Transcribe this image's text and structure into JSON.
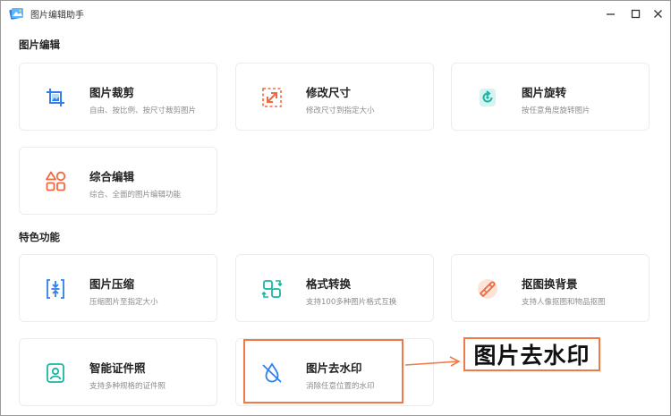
{
  "window": {
    "title": "图片编辑助手",
    "icons": {
      "app": "app-logo-icon",
      "minimize": "minimize-icon",
      "maximize": "maximize-icon",
      "close": "close-icon"
    }
  },
  "sections": [
    {
      "title": "图片编辑",
      "cards": [
        {
          "title": "图片裁剪",
          "desc": "自由、按比例、按尺寸裁剪图片",
          "icon": "crop-icon",
          "color": "#2f80ed"
        },
        {
          "title": "修改尺寸",
          "desc": "修改尺寸到指定大小",
          "icon": "resize-icon",
          "color": "#f06a3f"
        },
        {
          "title": "图片旋转",
          "desc": "按任意角度旋转图片",
          "icon": "rotate-icon",
          "color": "#19b5a5"
        },
        {
          "title": "综合编辑",
          "desc": "综合、全面的图片编辑功能",
          "icon": "grid-shapes-icon",
          "color": "#f06a3f"
        }
      ]
    },
    {
      "title": "特色功能",
      "cards": [
        {
          "title": "图片压缩",
          "desc": "压缩图片至指定大小",
          "icon": "compress-icon",
          "color": "#2f80ed"
        },
        {
          "title": "格式转换",
          "desc": "支持100多种图片格式互换",
          "icon": "convert-icon",
          "color": "#19b5a5"
        },
        {
          "title": "抠图换背景",
          "desc": "支持人像抠图和物品抠图",
          "icon": "cutout-icon",
          "color": "#f06a3f"
        },
        {
          "title": "智能证件照",
          "desc": "支持多种规格的证件照",
          "icon": "id-photo-icon",
          "color": "#19b5a5"
        },
        {
          "title": "图片去水印",
          "desc": "消除任意位置的水印",
          "icon": "watermark-remove-icon",
          "color": "#2f80ed"
        }
      ]
    }
  ],
  "annotation": {
    "label": "图片去水印",
    "color": "#ee7a45"
  }
}
